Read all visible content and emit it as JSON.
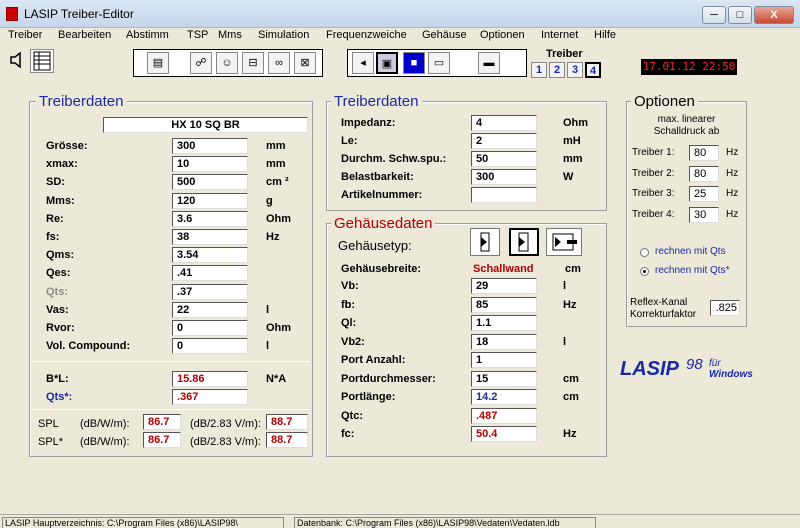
{
  "window": {
    "title": "LASIP  Treiber-Editor",
    "min": "─",
    "max": "□",
    "close": "X"
  },
  "menu": [
    "Treiber",
    "Bearbeiten",
    "Abstimm",
    "TSP",
    "Mms",
    "Simulation",
    "Frequenzweiche",
    "Gehäuse",
    "Optionen",
    "Internet",
    "Hilfe"
  ],
  "toolbar": {
    "treiber_label": "Treiber",
    "tabs": [
      "1",
      "2",
      "3",
      "4"
    ],
    "clock": "17.01.12  22:50"
  },
  "treiberdaten1": {
    "title": "Treiberdaten",
    "name": "HX 10 SQ BR",
    "rows": [
      {
        "label": "Grösse:",
        "value": "300",
        "unit": "mm"
      },
      {
        "label": "xmax:",
        "value": "10",
        "unit": "mm"
      },
      {
        "label": "SD:",
        "value": "500",
        "unit": "cm ²"
      },
      {
        "label": "Mms:",
        "value": "120",
        "unit": "g"
      },
      {
        "label": "Re:",
        "value": "3.6",
        "unit": "Ohm"
      },
      {
        "label": "fs:",
        "value": "38",
        "unit": "Hz"
      },
      {
        "label": "Qms:",
        "value": "3.54",
        "unit": ""
      },
      {
        "label": "Qes:",
        "value": ".41",
        "unit": ""
      },
      {
        "label": "Qts:",
        "value": ".37",
        "unit": ""
      },
      {
        "label": "Vas:",
        "value": "22",
        "unit": "l"
      },
      {
        "label": "Rvor:",
        "value": "0",
        "unit": "Ohm"
      },
      {
        "label": "Vol. Compound:",
        "value": "0",
        "unit": "l"
      }
    ],
    "bl_label": "B*L:",
    "bl_value": "15.86",
    "bl_unit": "N*A",
    "qtsstar_label": "Qts*:",
    "qtsstar_value": ".367",
    "spl_label": "SPL",
    "spl_unit1": "(dB/W/m):",
    "spl_value1": "86.7",
    "spl_unit2": "(dB/2.83 V/m):",
    "spl_value2": "88.7",
    "splstar_label": "SPL*",
    "splstar_unit1": "(dB/W/m):",
    "splstar_value1": "86.7",
    "splstar_unit2": "(dB/2.83 V/m):",
    "splstar_value2": "88.7"
  },
  "treiberdaten2": {
    "title": "Treiberdaten",
    "rows": [
      {
        "label": "Impedanz:",
        "value": "4",
        "unit": "Ohm"
      },
      {
        "label": "Le:",
        "value": "2",
        "unit": "mH"
      },
      {
        "label": "Durchm. Schw.spu.:",
        "value": "50",
        "unit": "mm"
      },
      {
        "label": "Belastbarkeit:",
        "value": "300",
        "unit": "W"
      },
      {
        "label": "Artikelnummer:",
        "value": "",
        "unit": ""
      }
    ]
  },
  "gehaeuse": {
    "title": "Gehäusedaten",
    "typ_label": "Gehäusetyp:",
    "breite_label": "Gehäusebreite:",
    "breite_value": "Schallwand",
    "breite_unit": "cm",
    "rows": [
      {
        "label": "Vb:",
        "value": "29",
        "unit": "l"
      },
      {
        "label": "fb:",
        "value": "85",
        "unit": "Hz"
      },
      {
        "label": "Ql:",
        "value": "1.1",
        "unit": ""
      },
      {
        "label": "Vb2:",
        "value": "18",
        "unit": "l"
      },
      {
        "label": "Port Anzahl:",
        "value": "1",
        "unit": ""
      },
      {
        "label": "Portdurchmesser:",
        "value": "15",
        "unit": "cm"
      },
      {
        "label": "Portlänge:",
        "value": "14.2",
        "unit": "cm"
      },
      {
        "label": "Qtc:",
        "value": ".487",
        "unit": ""
      },
      {
        "label": "fc:",
        "value": "50.4",
        "unit": "Hz"
      }
    ]
  },
  "optionen": {
    "title": "Optionen",
    "desc1": "max. linearer",
    "desc2": "Schalldruck ab",
    "rows": [
      {
        "label": "Treiber 1:",
        "value": "80",
        "unit": "Hz"
      },
      {
        "label": "Treiber 2:",
        "value": "80",
        "unit": "Hz"
      },
      {
        "label": "Treiber 3:",
        "value": "25",
        "unit": "Hz"
      },
      {
        "label": "Treiber 4:",
        "value": "30",
        "unit": "Hz"
      }
    ],
    "radio1": "rechnen mit Qts",
    "radio2": "rechnen mit Qts*",
    "reflex1": "Reflex-Kanal",
    "reflex2": "Korrekturfaktor",
    "reflex_value": ".825"
  },
  "logo": {
    "main": "LASIP",
    "num": "98",
    "fuer": "für",
    "windows": "Windows"
  },
  "status": {
    "left": "LASIP Hauptverzeichnis: C:\\Program Files (x86)\\LASIP98\\",
    "right": "Datenbank: C:\\Program Files (x86)\\LASIP98\\Vedaten\\Vedaten.ldb"
  }
}
